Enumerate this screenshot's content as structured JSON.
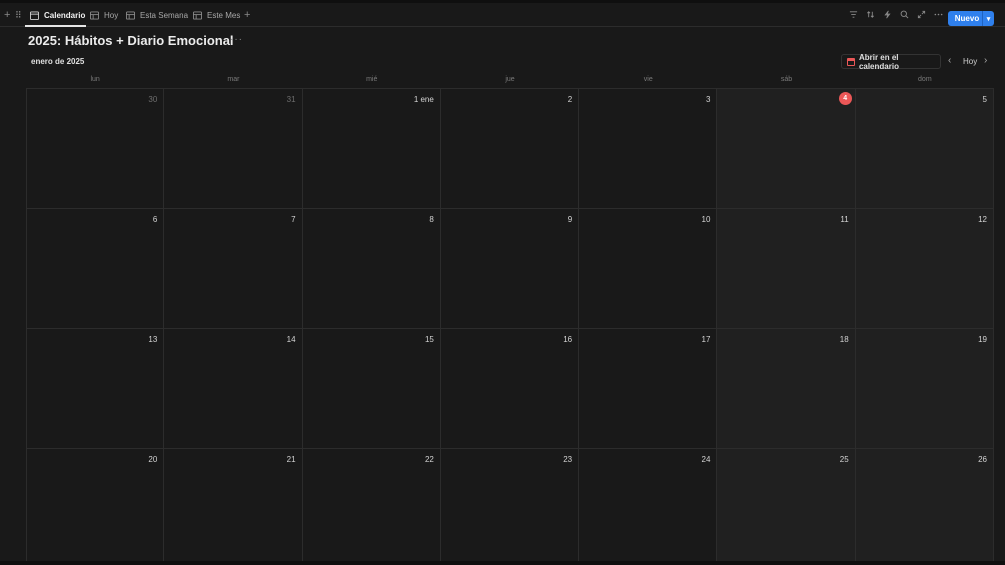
{
  "tabs": [
    {
      "label": "Calendario",
      "icon": "calendar-icon",
      "active": true
    },
    {
      "label": "Hoy",
      "icon": "table-icon"
    },
    {
      "label": "Esta Semana",
      "icon": "table-icon"
    },
    {
      "label": "Este Mes",
      "icon": "table-icon"
    }
  ],
  "toolbar": {
    "add_tab_label": "+",
    "new_button": "Nuevo",
    "right_icons": [
      "filter-icon",
      "sort-icon",
      "lightning-icon",
      "search-icon",
      "expand-icon",
      "more-icon"
    ]
  },
  "page": {
    "title": "2025: Hábitos + Diario Emocional",
    "title_more": "···"
  },
  "calendar": {
    "month_label": "enero de 2025",
    "open_in_calendar": "Abrir en el calendario",
    "today_button": "Hoy",
    "weekdays": [
      "lun",
      "mar",
      "mié",
      "jue",
      "vie",
      "sáb",
      "dom"
    ],
    "today": "4",
    "accent_color": "#eb5757",
    "weeks": [
      [
        "30",
        "31",
        "1 ene",
        "2",
        "3",
        "4",
        "5"
      ],
      [
        "6",
        "7",
        "8",
        "9",
        "10",
        "11",
        "12"
      ],
      [
        "13",
        "14",
        "15",
        "16",
        "17",
        "18",
        "19"
      ],
      [
        "20",
        "21",
        "22",
        "23",
        "24",
        "25",
        "26"
      ]
    ],
    "muted_days": [
      "30",
      "31"
    ]
  },
  "colors": {
    "background": "#191919",
    "primary_button": "#2f80ed"
  }
}
